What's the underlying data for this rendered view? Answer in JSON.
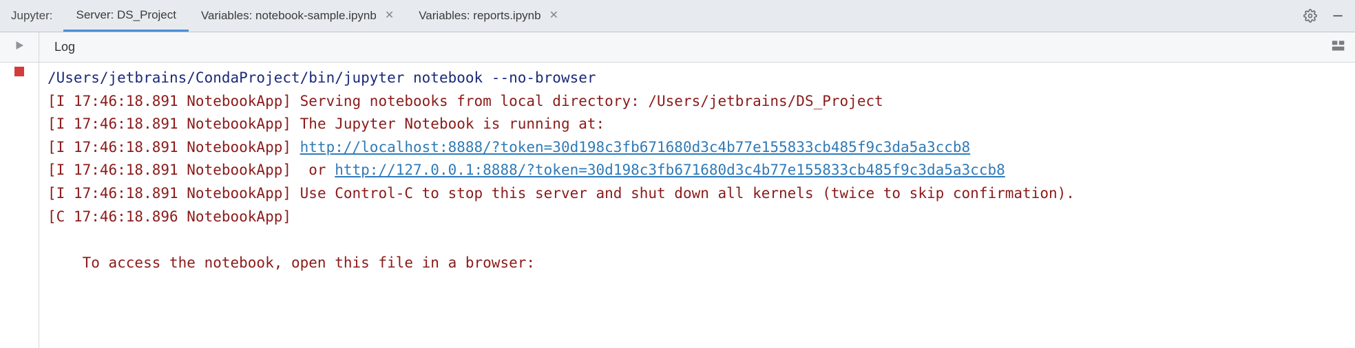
{
  "tabbar": {
    "label": "Jupyter:",
    "tabs": [
      {
        "label": "Server: DS_Project",
        "closable": false,
        "active": true
      },
      {
        "label": "Variables: notebook-sample.ipynb",
        "closable": true,
        "active": false
      },
      {
        "label": "Variables: reports.ipynb",
        "closable": true,
        "active": false
      }
    ]
  },
  "toolbar": {
    "log_label": "Log"
  },
  "log": {
    "cmd": "/Users/jetbrains/CondaProject/bin/jupyter notebook --no-browser",
    "lines": [
      {
        "prefix": "[I 17:46:18.891 NotebookApp] ",
        "text": "Serving notebooks from local directory: /Users/jetbrains/DS_Project"
      },
      {
        "prefix": "[I 17:46:18.891 NotebookApp] ",
        "text": "The Jupyter Notebook is running at:"
      },
      {
        "prefix": "[I 17:46:18.891 NotebookApp] ",
        "link": "http://localhost:8888/?token=30d198c3fb671680d3c4b77e155833cb485f9c3da5a3ccb8"
      },
      {
        "prefix": "[I 17:46:18.891 NotebookApp]  or ",
        "link": "http://127.0.0.1:8888/?token=30d198c3fb671680d3c4b77e155833cb485f9c3da5a3ccb8"
      },
      {
        "prefix": "[I 17:46:18.891 NotebookApp] ",
        "text": "Use Control-C to stop this server and shut down all kernels (twice to skip confirmation)."
      },
      {
        "prefix": "[C 17:46:18.896 NotebookApp]",
        "text": ""
      }
    ],
    "tail": "    To access the notebook, open this file in a browser:"
  }
}
